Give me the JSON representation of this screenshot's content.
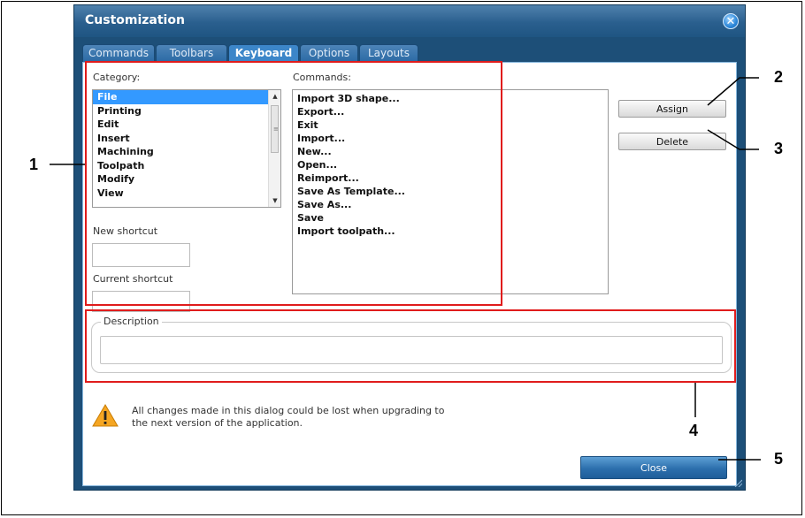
{
  "dialog": {
    "title": "Customization",
    "close_glyph": "✕",
    "tabs": [
      {
        "label": "Commands",
        "active": false
      },
      {
        "label": "Toolbars",
        "active": false
      },
      {
        "label": "Keyboard",
        "active": true
      },
      {
        "label": "Options",
        "active": false
      },
      {
        "label": "Layouts",
        "active": false
      }
    ],
    "category": {
      "label": "Category:",
      "items": [
        "File",
        "Printing",
        "Edit",
        "Insert",
        "Machining",
        "Toolpath",
        "Modify",
        "View"
      ],
      "selected": "File"
    },
    "commands": {
      "label": "Commands:",
      "items": [
        "Import 3D shape...",
        "Export...",
        "Exit",
        "Import...",
        "New...",
        "Open...",
        "Reimport...",
        "Save As Template...",
        "Save As...",
        "Save",
        "Import toolpath..."
      ]
    },
    "new_shortcut_label": "New shortcut",
    "current_shortcut_label": "Current shortcut",
    "assign_label": "Assign",
    "delete_label": "Delete",
    "description_label": "Description",
    "warning_text_line1": "All changes made in this dialog could be lost when upgrading to",
    "warning_text_line2": "the next version of the application.",
    "close_label": "Close",
    "warning_icon": "warning-triangle-icon"
  },
  "callouts": [
    "1",
    "2",
    "3",
    "4",
    "5"
  ],
  "colors": {
    "dialog_frame": "#1d4f78",
    "selection": "#3399ff",
    "highlight_box": "#e01c1c",
    "close_button": "#2c6fad"
  }
}
